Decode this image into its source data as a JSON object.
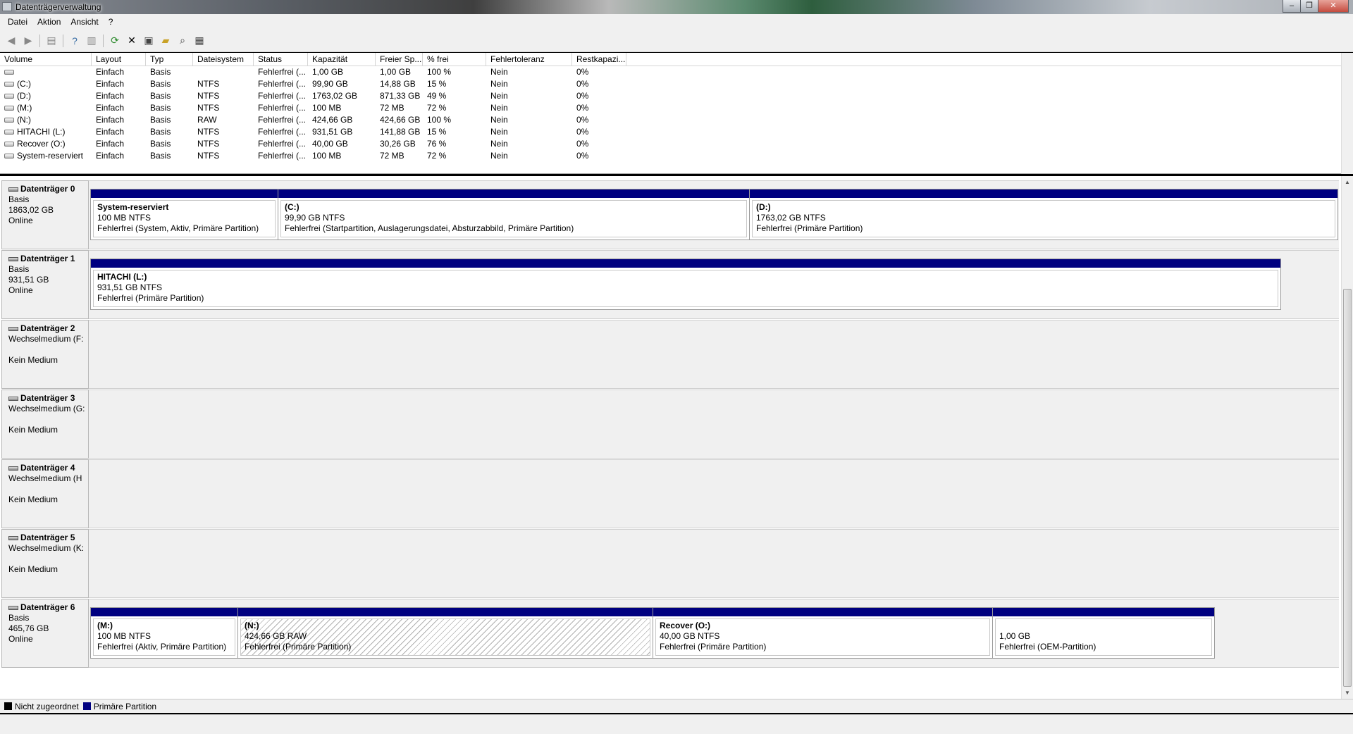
{
  "window": {
    "title": "Datenträgerverwaltung",
    "buttons": [
      "–",
      "❐",
      "✕"
    ]
  },
  "menu": [
    "Datei",
    "Aktion",
    "Ansicht",
    "?"
  ],
  "toolbar": [
    "back-icon",
    "forward-icon",
    "console-tree-icon",
    "help-icon",
    "action-pane-icon",
    "refresh-icon",
    "delete-icon",
    "properties-icon",
    "open-icon",
    "explore-icon",
    "rescan-icon"
  ],
  "volume_list": {
    "columns": [
      "Volume",
      "Layout",
      "Typ",
      "Dateisystem",
      "Status",
      "Kapazität",
      "Freier Sp...",
      "% frei",
      "Fehlertoleranz",
      "Restkapazi..."
    ],
    "rows": [
      [
        "",
        "Einfach",
        "Basis",
        "",
        "Fehlerfrei (...",
        "1,00 GB",
        "1,00 GB",
        "100 %",
        "Nein",
        "0%"
      ],
      [
        "(C:)",
        "Einfach",
        "Basis",
        "NTFS",
        "Fehlerfrei (...",
        "99,90 GB",
        "14,88 GB",
        "15 %",
        "Nein",
        "0%"
      ],
      [
        "(D:)",
        "Einfach",
        "Basis",
        "NTFS",
        "Fehlerfrei (...",
        "1763,02 GB",
        "871,33 GB",
        "49 %",
        "Nein",
        "0%"
      ],
      [
        "(M:)",
        "Einfach",
        "Basis",
        "NTFS",
        "Fehlerfrei (...",
        "100 MB",
        "72 MB",
        "72 %",
        "Nein",
        "0%"
      ],
      [
        "(N:)",
        "Einfach",
        "Basis",
        "RAW",
        "Fehlerfrei (...",
        "424,66 GB",
        "424,66 GB",
        "100 %",
        "Nein",
        "0%"
      ],
      [
        "HITACHI (L:)",
        "Einfach",
        "Basis",
        "NTFS",
        "Fehlerfrei (...",
        "931,51 GB",
        "141,88 GB",
        "15 %",
        "Nein",
        "0%"
      ],
      [
        "Recover (O:)",
        "Einfach",
        "Basis",
        "NTFS",
        "Fehlerfrei (...",
        "40,00 GB",
        "30,26 GB",
        "76 %",
        "Nein",
        "0%"
      ],
      [
        "System-reserviert",
        "Einfach",
        "Basis",
        "NTFS",
        "Fehlerfrei (...",
        "100 MB",
        "72 MB",
        "72 %",
        "Nein",
        "0%"
      ]
    ]
  },
  "disks": {
    "d0": {
      "name": "Datenträger 0",
      "type": "Basis",
      "size": "1863,02 GB",
      "state": "Online",
      "p0": {
        "title": "System-reserviert",
        "size": "100 MB NTFS",
        "status": "Fehlerfrei (System, Aktiv, Primäre Partition)"
      },
      "p1": {
        "title": "(C:)",
        "size": "99,90 GB NTFS",
        "status": "Fehlerfrei (Startpartition, Auslagerungsdatei, Absturzabbild, Primäre Partition)"
      },
      "p2": {
        "title": "(D:)",
        "size": "1763,02 GB NTFS",
        "status": "Fehlerfrei (Primäre Partition)"
      }
    },
    "d1": {
      "name": "Datenträger 1",
      "type": "Basis",
      "size": "931,51 GB",
      "state": "Online",
      "p0": {
        "title": "HITACHI  (L:)",
        "size": "931,51 GB NTFS",
        "status": "Fehlerfrei (Primäre Partition)"
      }
    },
    "d2": {
      "name": "Datenträger 2",
      "type": "Wechselmedium (F:",
      "state": "Kein Medium"
    },
    "d3": {
      "name": "Datenträger 3",
      "type": "Wechselmedium (G:",
      "state": "Kein Medium"
    },
    "d4": {
      "name": "Datenträger 4",
      "type": "Wechselmedium (H",
      "state": "Kein Medium"
    },
    "d5": {
      "name": "Datenträger 5",
      "type": "Wechselmedium (K:",
      "state": "Kein Medium"
    },
    "d6": {
      "name": "Datenträger 6",
      "type": "Basis",
      "size": "465,76 GB",
      "state": "Online",
      "p0": {
        "title": "(M:)",
        "size": "100 MB NTFS",
        "status": "Fehlerfrei (Aktiv, Primäre Partition)"
      },
      "p1": {
        "title": "(N:)",
        "size": "424,66 GB RAW",
        "status": "Fehlerfrei (Primäre Partition)"
      },
      "p2": {
        "title": "Recover  (O:)",
        "size": "40,00 GB NTFS",
        "status": "Fehlerfrei (Primäre Partition)"
      },
      "p3": {
        "title": "",
        "size": "1,00 GB",
        "status": "Fehlerfrei (OEM-Partition)"
      }
    }
  },
  "legend": {
    "unallocated": "Nicht zugeordnet",
    "primary": "Primäre Partition",
    "unallocated_color": "#000000",
    "primary_color": "#000080"
  }
}
